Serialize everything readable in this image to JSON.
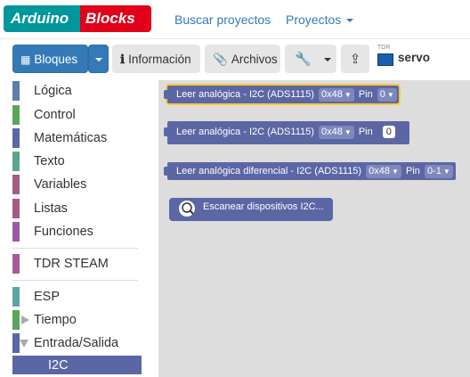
{
  "brand": {
    "part1": "Arduino",
    "part2": "Blocks"
  },
  "nav": {
    "search_projects": "Buscar proyectos",
    "projects": "Proyectos"
  },
  "toolbar": {
    "blocks": "Bloques",
    "info": "Información",
    "files": "Archivos",
    "project_name": "servo",
    "board_label": "TDR"
  },
  "sidebar": {
    "categories": [
      {
        "label": "Lógica",
        "color": "#5b80a5"
      },
      {
        "label": "Control",
        "color": "#5ba55b"
      },
      {
        "label": "Matemáticas",
        "color": "#5b67a5"
      },
      {
        "label": "Texto",
        "color": "#5ba58c"
      },
      {
        "label": "Variables",
        "color": "#a55b80"
      },
      {
        "label": "Listas",
        "color": "#a55b80"
      },
      {
        "label": "Funciones",
        "color": "#995ba5"
      },
      {
        "label": "TDR STEAM",
        "color": "#a55b99"
      },
      {
        "label": "ESP",
        "color": "#5ba5a5"
      },
      {
        "label": "Tiempo",
        "color": "#5ba55b"
      },
      {
        "label": "Entrada/Salida",
        "color": "#5b67a5"
      },
      {
        "label": "I2C",
        "color": "#5b67a5"
      }
    ]
  },
  "blocks": [
    {
      "text": "Leer analógica - I2C (ADS1115)",
      "addr": "0x48",
      "pin_label": "Pin",
      "pin": "0"
    },
    {
      "text": "Leer analógica - I2C (ADS1115)",
      "addr": "0x48",
      "pin_label": "Pin",
      "pin": "0"
    },
    {
      "text": "Leer analógica diferencial - I2C (ADS1115)",
      "addr": "0x48",
      "pin_label": "Pin",
      "pin": "0-1"
    },
    {
      "text": "Escanear dispositivos I2C..."
    }
  ],
  "scan_icon_label": "I2C"
}
